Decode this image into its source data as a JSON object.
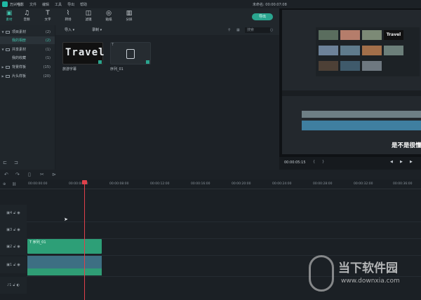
{
  "titlebar": {
    "app": "万兴喵影",
    "menus": [
      "文件",
      "编辑",
      "工具",
      "导出",
      "帮助"
    ],
    "doc": "未命名: 00:00:07:08"
  },
  "toolbar": {
    "items": [
      {
        "label": "素材",
        "icon": "folder-icon",
        "active": true
      },
      {
        "label": "音频",
        "icon": "music-icon"
      },
      {
        "label": "文字",
        "icon": "text-icon"
      },
      {
        "label": "转场",
        "icon": "transition-icon"
      },
      {
        "label": "滤镜",
        "icon": "filter-icon"
      },
      {
        "label": "贴纸",
        "icon": "sticker-icon"
      },
      {
        "label": "分屏",
        "icon": "splitscreen-icon"
      }
    ],
    "export": "导出"
  },
  "sidebar": {
    "items": [
      {
        "label": "项目素材",
        "count": "(2)"
      },
      {
        "label": "我的相册",
        "count": "(2)",
        "selected": true
      },
      {
        "label": "共享素材",
        "count": "(1)"
      },
      {
        "label": "我的收藏",
        "count": "(1)"
      },
      {
        "label": "背景样板",
        "count": "(15)"
      },
      {
        "label": "片头样板",
        "count": "(20)"
      }
    ]
  },
  "mediabar": {
    "import": "导入",
    "record": "录制",
    "search": "搜索"
  },
  "media": {
    "items": [
      {
        "name": "旅游字幕",
        "text": "Travel"
      },
      {
        "name": "序列_01"
      }
    ]
  },
  "preview": {
    "time": "00:00:05:15",
    "subtitle": "是不是很懂"
  },
  "timeline": {
    "ticks": [
      "00:00:00:00",
      "00:00:04:00",
      "00:00:08:00",
      "00:00:12:00",
      "00:00:16:00",
      "00:00:20:00",
      "00:00:24:00",
      "00:00:28:00",
      "00:00:32:00",
      "00:00:36:00"
    ],
    "clips": {
      "title_clip": "T 序列_01"
    }
  },
  "watermark": {
    "brand": "当下软件园",
    "url": "www.downxia.com"
  }
}
